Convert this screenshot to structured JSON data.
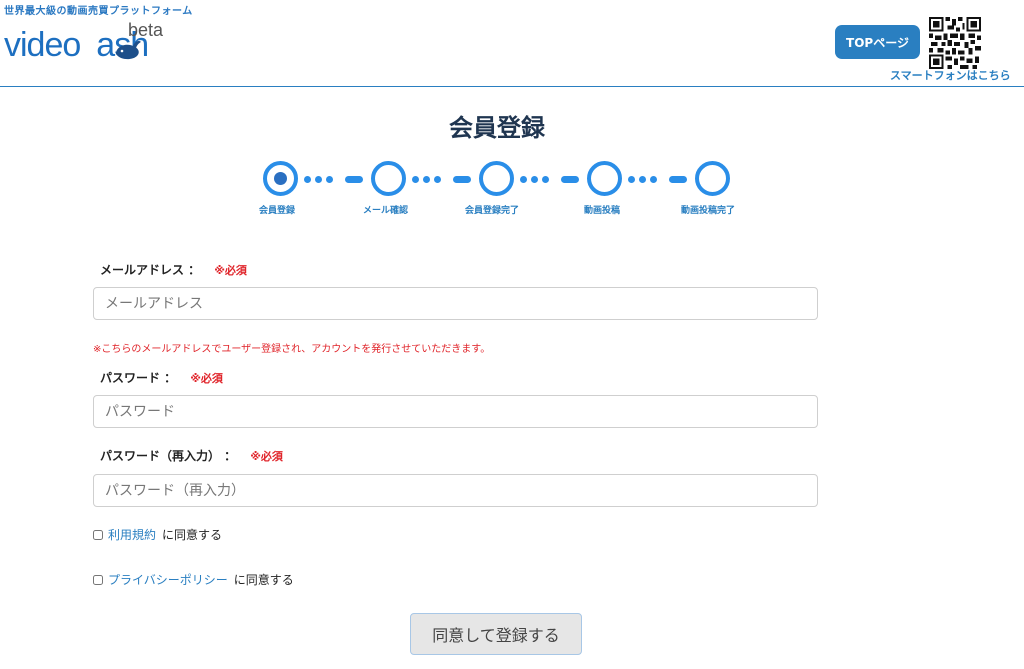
{
  "header": {
    "tagline": "世界最大級の動画売買プラットフォーム",
    "logo_text": "videocash",
    "logo_beta": "beta",
    "top_button": "TOPページ",
    "smartphone_link": "スマートフォンはこちら",
    "brand_color": "#2a7fc1"
  },
  "page_title": "会員登録",
  "steps": [
    {
      "label": "会員登録",
      "active": true
    },
    {
      "label": "メール確認",
      "active": false
    },
    {
      "label": "会員登録完了",
      "active": false
    },
    {
      "label": "動画投稿",
      "active": false
    },
    {
      "label": "動画投稿完了",
      "active": false
    }
  ],
  "form": {
    "required_mark": "※必須",
    "email": {
      "label": "メールアドレス ：",
      "placeholder": "メールアドレス",
      "value": ""
    },
    "email_note": "※こちらのメールアドレスでユーザー登録され、アカウントを発行させていただきます。",
    "password": {
      "label": "パスワード ：",
      "placeholder": "パスワード",
      "value": ""
    },
    "password_confirm": {
      "label": "パスワード（再入力） ：",
      "placeholder": "パスワード（再入力）",
      "value": ""
    },
    "terms": {
      "link": "利用規約",
      "suffix": "に同意する",
      "checked": false
    },
    "privacy": {
      "link": "プライバシーポリシー",
      "suffix": "に同意する",
      "checked": false
    },
    "submit_label": "同意して登録する"
  }
}
